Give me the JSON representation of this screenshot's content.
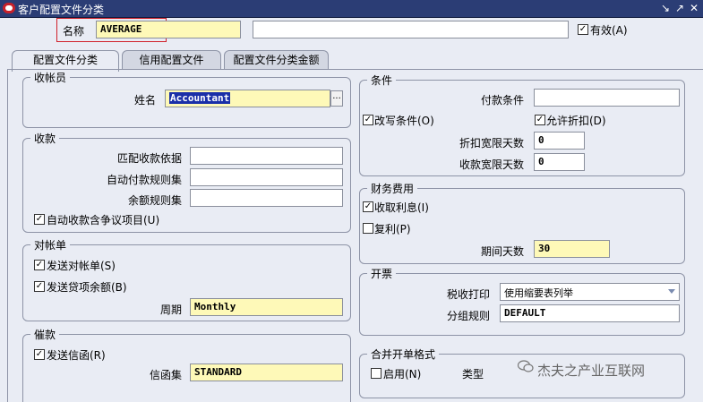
{
  "window": {
    "title": "客户配置文件分类",
    "controls": [
      "↘",
      "↗",
      "✕"
    ]
  },
  "header": {
    "name_label": "名称",
    "name_value": "AVERAGE",
    "description_value": "",
    "active_label": "有效(A)",
    "active_checked": true
  },
  "tabs": [
    {
      "label": "配置文件分类",
      "active": true
    },
    {
      "label": "信用配置文件",
      "active": false
    },
    {
      "label": "配置文件分类金额",
      "active": false
    }
  ],
  "collector": {
    "title": "收帐员",
    "name_label": "姓名",
    "name_value": "Accountant",
    "lov_glyph": "..."
  },
  "receipts": {
    "title": "收款",
    "match_label": "匹配收款依据",
    "match_value": "",
    "autocash_label": "自动付款规则集",
    "autocash_value": "",
    "remainder_label": "余额规则集",
    "remainder_value": "",
    "dispute_label": "自动收款含争议项目(U)",
    "dispute_checked": true
  },
  "statements": {
    "title": "对帐单",
    "send_label": "发送对帐单(S)",
    "send_checked": true,
    "credit_balance_label": "发送贷项余额(B)",
    "credit_balance_checked": true,
    "cycle_label": "周期",
    "cycle_value": "Monthly"
  },
  "dunning": {
    "title": "催款",
    "send_label": "发送信函(R)",
    "send_checked": true,
    "letterset_label": "信函集",
    "letterset_value": "STANDARD"
  },
  "terms": {
    "title": "条件",
    "payment_terms_label": "付款条件",
    "payment_terms_value": "",
    "override_label": "改写条件(O)",
    "override_checked": true,
    "discount_label": "允许折扣(D)",
    "discount_checked": true,
    "discount_grace_label": "折扣宽限天数",
    "discount_grace_value": "0",
    "receipt_grace_label": "收款宽限天数",
    "receipt_grace_value": "0"
  },
  "finance_charges": {
    "title": "财务费用",
    "charge_interest_label": "收取利息(I)",
    "charge_interest_checked": true,
    "compound_label": "复利(P)",
    "compound_checked": false,
    "period_label": "期间天数",
    "period_value": "30"
  },
  "invoicing": {
    "title": "开票",
    "tax_print_label": "税收打印",
    "tax_print_value": "使用缩要表列举",
    "grouping_label": "分组规则",
    "grouping_value": "DEFAULT"
  },
  "consolidated": {
    "title": "合并开单格式",
    "enable_label": "启用(N)",
    "enable_checked": false,
    "type_label": "类型"
  },
  "watermark": {
    "text": "杰夫之产业互联网"
  },
  "colors": {
    "titlebar": "#2b3d75",
    "panel": "#e9ecf4",
    "required_field": "#fef9b8",
    "highlight_box": "#d0202a"
  }
}
